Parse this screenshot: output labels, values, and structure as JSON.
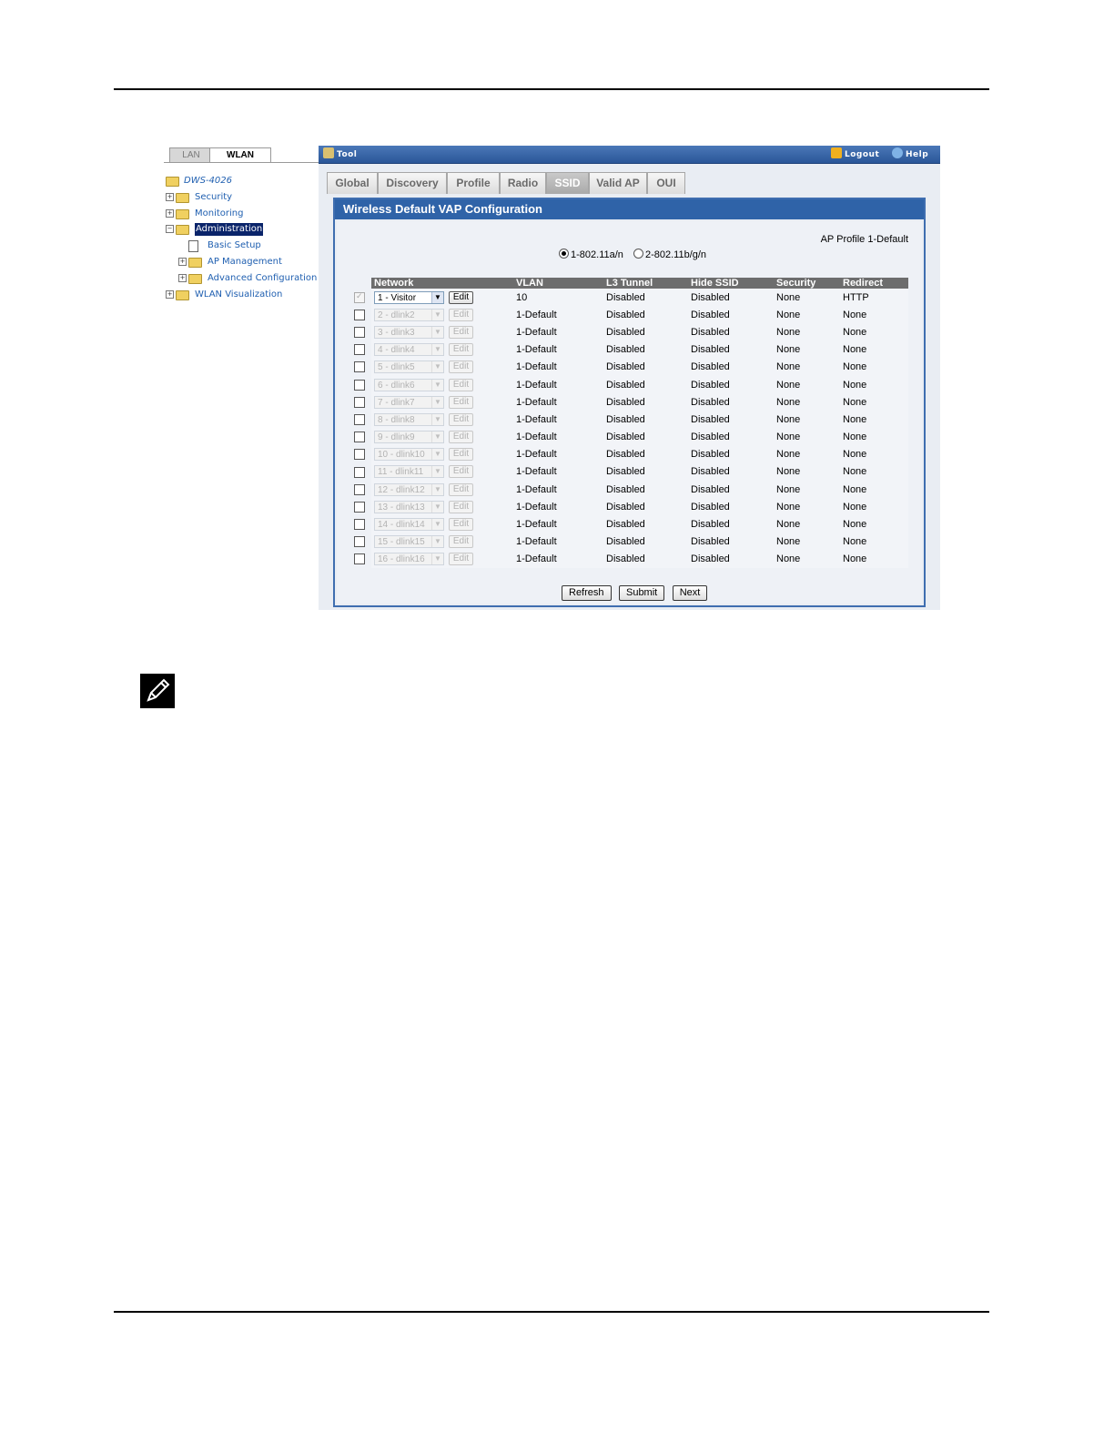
{
  "nav": {
    "tabs": [
      "LAN",
      "WLAN"
    ],
    "tree": {
      "root": "DWS-4026",
      "items": [
        {
          "label": "Security"
        },
        {
          "label": "Monitoring"
        },
        {
          "label": "Administration"
        },
        {
          "label": "Basic Setup"
        },
        {
          "label": "AP Management"
        },
        {
          "label": "Advanced Configuration"
        },
        {
          "label": "WLAN Visualization"
        }
      ]
    }
  },
  "toolbar": {
    "tool": "Tool",
    "logout": "Logout",
    "help": "Help"
  },
  "tabs": [
    "Global",
    "Discovery",
    "Profile",
    "Radio",
    "SSID",
    "Valid AP",
    "OUI"
  ],
  "active_tab": "SSID",
  "panel": {
    "title": "Wireless Default VAP Configuration",
    "profile": "AP Profile 1-Default",
    "radio1": "1-802.11a/n",
    "radio2": "2-802.11b/g/n"
  },
  "table": {
    "columns": [
      "Network",
      "VLAN",
      "L3 Tunnel",
      "Hide SSID",
      "Security",
      "Redirect"
    ],
    "rows": [
      {
        "network": "1 - Visitor",
        "vlan": "10",
        "l3": "Disabled",
        "hide": "Disabled",
        "security": "None",
        "redirect": "HTTP"
      },
      {
        "network": "2 - dlink2",
        "vlan": "1-Default",
        "l3": "Disabled",
        "hide": "Disabled",
        "security": "None",
        "redirect": "None"
      },
      {
        "network": "3 - dlink3",
        "vlan": "1-Default",
        "l3": "Disabled",
        "hide": "Disabled",
        "security": "None",
        "redirect": "None"
      },
      {
        "network": "4 - dlink4",
        "vlan": "1-Default",
        "l3": "Disabled",
        "hide": "Disabled",
        "security": "None",
        "redirect": "None"
      },
      {
        "network": "5 - dlink5",
        "vlan": "1-Default",
        "l3": "Disabled",
        "hide": "Disabled",
        "security": "None",
        "redirect": "None"
      },
      {
        "network": "6 - dlink6",
        "vlan": "1-Default",
        "l3": "Disabled",
        "hide": "Disabled",
        "security": "None",
        "redirect": "None"
      },
      {
        "network": "7 - dlink7",
        "vlan": "1-Default",
        "l3": "Disabled",
        "hide": "Disabled",
        "security": "None",
        "redirect": "None"
      },
      {
        "network": "8 - dlink8",
        "vlan": "1-Default",
        "l3": "Disabled",
        "hide": "Disabled",
        "security": "None",
        "redirect": "None"
      },
      {
        "network": "9 - dlink9",
        "vlan": "1-Default",
        "l3": "Disabled",
        "hide": "Disabled",
        "security": "None",
        "redirect": "None"
      },
      {
        "network": "10 - dlink10",
        "vlan": "1-Default",
        "l3": "Disabled",
        "hide": "Disabled",
        "security": "None",
        "redirect": "None"
      },
      {
        "network": "11 - dlink11",
        "vlan": "1-Default",
        "l3": "Disabled",
        "hide": "Disabled",
        "security": "None",
        "redirect": "None"
      },
      {
        "network": "12 - dlink12",
        "vlan": "1-Default",
        "l3": "Disabled",
        "hide": "Disabled",
        "security": "None",
        "redirect": "None"
      },
      {
        "network": "13 - dlink13",
        "vlan": "1-Default",
        "l3": "Disabled",
        "hide": "Disabled",
        "security": "None",
        "redirect": "None"
      },
      {
        "network": "14 - dlink14",
        "vlan": "1-Default",
        "l3": "Disabled",
        "hide": "Disabled",
        "security": "None",
        "redirect": "None"
      },
      {
        "network": "15 - dlink15",
        "vlan": "1-Default",
        "l3": "Disabled",
        "hide": "Disabled",
        "security": "None",
        "redirect": "None"
      },
      {
        "network": "16 - dlink16",
        "vlan": "1-Default",
        "l3": "Disabled",
        "hide": "Disabled",
        "security": "None",
        "redirect": "None"
      }
    ],
    "edit_label": "Edit"
  },
  "buttons": {
    "refresh": "Refresh",
    "submit": "Submit",
    "next": "Next"
  },
  "colors": {
    "header_blue": "#2f63a8",
    "toolbar_blue": "#3a68ad",
    "selected": "#0a246a"
  },
  "icons": {
    "tool": "tool-icon",
    "logout": "logout-icon",
    "help": "help-icon",
    "note": "note-pencil-icon"
  }
}
